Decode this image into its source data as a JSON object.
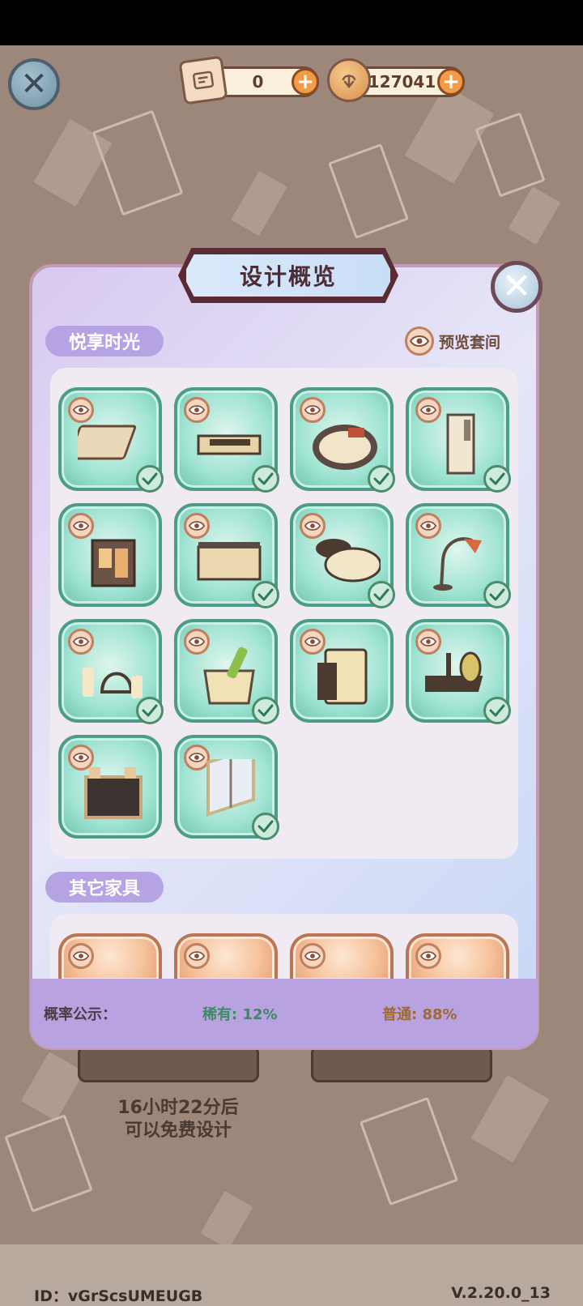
{
  "header": {
    "scroll_count": "0",
    "coin_count": "127041",
    "plus": "+"
  },
  "icons": {
    "close": "✕",
    "scroll": "scroll-icon",
    "coin": "coin-icon",
    "eye": "eye-icon",
    "check": "check-icon"
  },
  "dialog": {
    "title": "设计概览",
    "section1_title": "悦享时光",
    "preview_label": "预览套间",
    "section2_title": "其它家具",
    "items": [
      {
        "name": "rug",
        "owned": true
      },
      {
        "name": "tv-cabinet",
        "owned": true
      },
      {
        "name": "round-bed",
        "owned": true
      },
      {
        "name": "air-conditioner",
        "owned": true
      },
      {
        "name": "drinks-cart",
        "owned": false
      },
      {
        "name": "sideboard",
        "owned": true
      },
      {
        "name": "round-coffee-table",
        "owned": true
      },
      {
        "name": "floor-lamp",
        "owned": true
      },
      {
        "name": "candles",
        "owned": true
      },
      {
        "name": "champagne-bucket",
        "owned": true
      },
      {
        "name": "mini-fridge",
        "owned": false
      },
      {
        "name": "aroma-tray",
        "owned": true
      },
      {
        "name": "menu-board",
        "owned": false
      },
      {
        "name": "window",
        "owned": true
      }
    ],
    "probability": {
      "label": "概率公示：",
      "rare": "稀有: 12%",
      "common": "普通: 88%"
    }
  },
  "background": {
    "free_design_text_line1": "16小时22分后",
    "free_design_text_line2": "可以免费设计"
  },
  "footer": {
    "id_text": "ID：vGrScsUMEUGB",
    "version": "V.2.20.0_13"
  },
  "colors": {
    "accent_purple": "#b6a3e3",
    "tile_teal": "#9fe3d2",
    "rare_green": "#3b8a63",
    "common_orange": "#a0692f"
  }
}
